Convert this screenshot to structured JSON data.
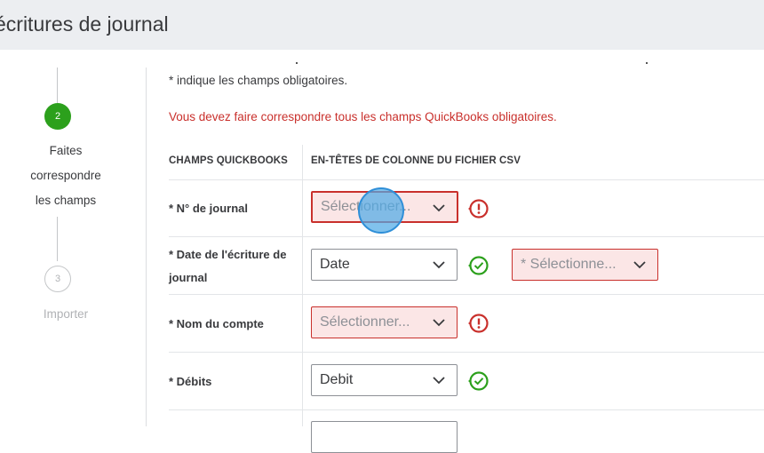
{
  "header": {
    "title": "écritures de journal"
  },
  "steps": {
    "active": {
      "number": "2",
      "label_line1": "Faites",
      "label_line2": "correspondre",
      "label_line3": "les champs"
    },
    "next": {
      "number": "3",
      "label": "Importer"
    }
  },
  "main": {
    "required_note": "* indique les champs obligatoires.",
    "error_message": "Vous devez faire correspondre tous les champs QuickBooks obligatoires.",
    "col_quickbooks": "CHAMPS QUICKBOOKS",
    "col_csv": "EN-TÊTES DE COLONNE DU FICHIER CSV"
  },
  "rows": [
    {
      "label": "* N° de journal",
      "select": "Sélectionner...",
      "status": "error"
    },
    {
      "label_line1": "* Date de l'écriture de",
      "label_line2": "journal",
      "select": "Date",
      "status": "ok",
      "extra_select": "* Sélectionne..."
    },
    {
      "label": "* Nom du compte",
      "select": "Sélectionner...",
      "status": "error"
    },
    {
      "label": "* Débits",
      "select": "Debit",
      "status": "ok"
    }
  ],
  "colors": {
    "success": "#2ca01c",
    "error": "#c9302c",
    "cursor": "#2f8fd8"
  },
  "icons": {
    "chevron": "chevron-down-icon",
    "error": "error-exclamation-icon",
    "success": "check-circle-icon"
  }
}
